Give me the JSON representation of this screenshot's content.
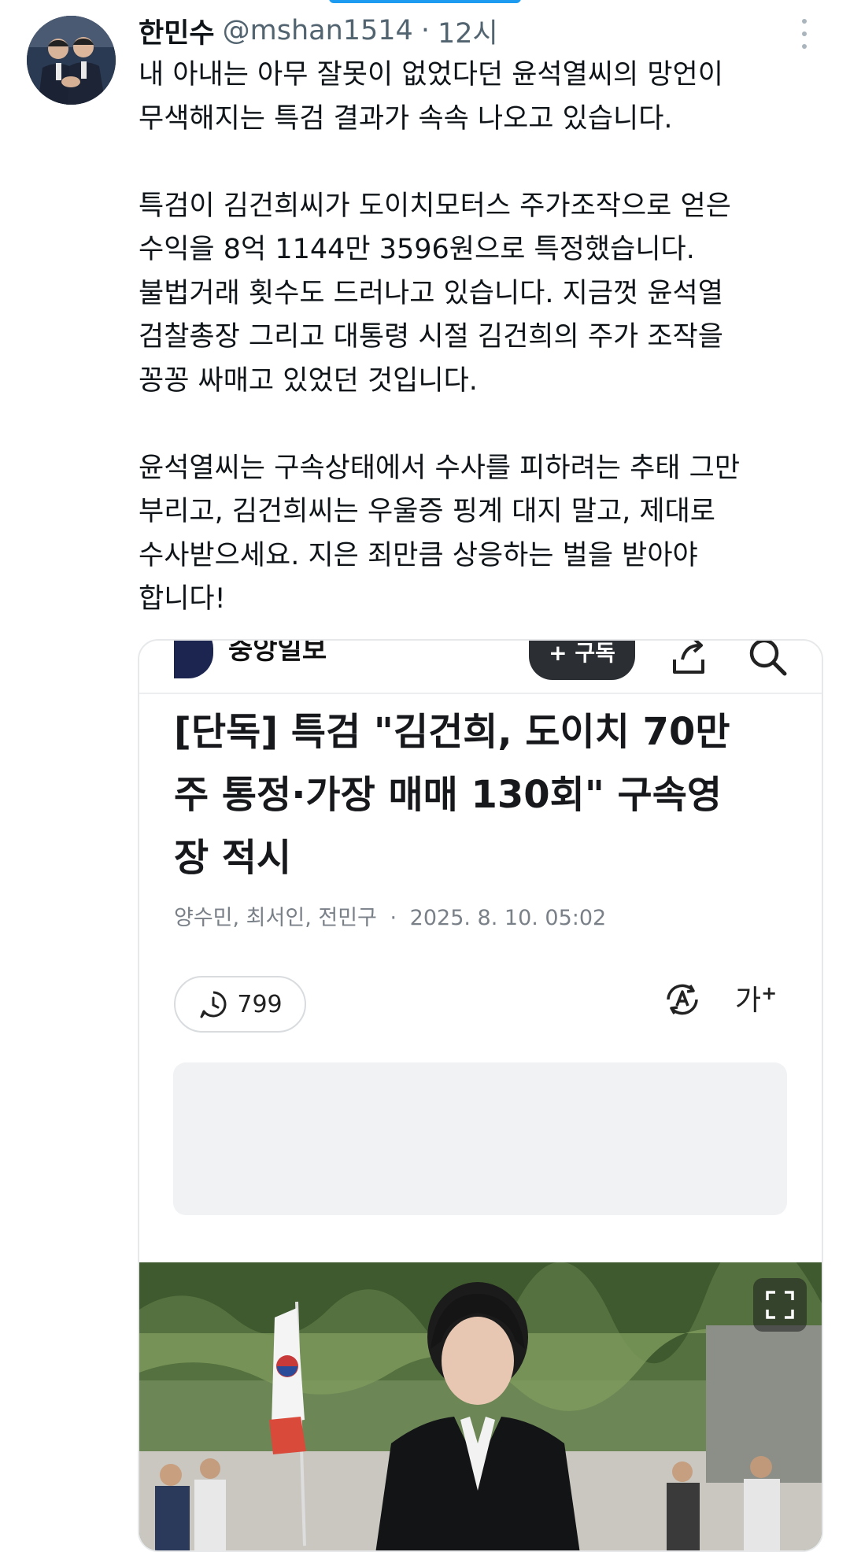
{
  "tweet": {
    "author_name": "한민수",
    "handle": "@mshan1514",
    "separator": "·",
    "time": "12시",
    "paragraphs": [
      [
        "내 아내는 아무 잘못이 없었다던 윤석열씨의 망언이",
        "무색해지는 특검 결과가 속속 나오고 있습니다."
      ],
      [
        "특검이 김건희씨가 도이치모터스 주가조작으로 얻은",
        "수익을 8억 1144만 3596원으로 특정했습니다.",
        "불법거래 횟수도 드러나고 있습니다. 지금껏 윤석열",
        "검찰총장 그리고 대통령 시절 김건희의 주가 조작을",
        "꽁꽁 싸매고 있었던 것입니다."
      ],
      [
        "윤석열씨는 구속상태에서 수사를 피하려는 추태 그만",
        "부리고, 김건희씨는 우울증 핑계 대지 말고, 제대로",
        "수사받으세요. 지은 죄만큼 상응하는 벌을 받아야",
        "합니다!"
      ]
    ]
  },
  "card": {
    "brand": "중앙일보",
    "subscribe_label": "+ 구독",
    "headline_lines": [
      "[단독] 특검 \"김건희, 도이치 70만",
      "주 통정·가장 매매 130회\" 구속영",
      "장 적시"
    ],
    "byline": {
      "authors": "양수민, 최서인, 전민구",
      "separator": "·",
      "date": "2025. 8. 10. 05:02"
    },
    "comment_count": "799",
    "font_size_label": "가",
    "font_size_plus": "+"
  },
  "colors": {
    "accent": "#1d9bf0",
    "text": "#0f1419",
    "secondary": "#536471",
    "brand_navy": "#1b2550"
  },
  "icons": [
    "more-vertical-icon",
    "share-icon",
    "search-icon",
    "clock-comment-icon",
    "read-aloud-icon",
    "expand-icon"
  ]
}
